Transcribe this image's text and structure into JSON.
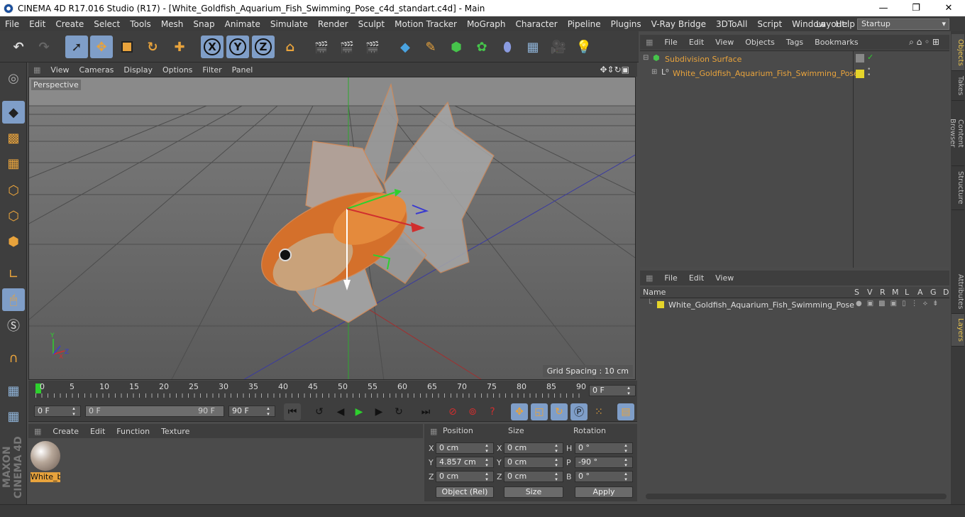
{
  "window": {
    "title": "CINEMA 4D R17.016 Studio (R17) - [White_Goldfish_Aquarium_Fish_Swimming_Pose_c4d_standart.c4d] - Main",
    "minimize": "—",
    "maximize": "❐",
    "close": "✕"
  },
  "menu": {
    "items": [
      "File",
      "Edit",
      "Create",
      "Select",
      "Tools",
      "Mesh",
      "Snap",
      "Animate",
      "Simulate",
      "Render",
      "Sculpt",
      "Motion Tracker",
      "MoGraph",
      "Character",
      "Pipeline",
      "Plugins",
      "V-Ray Bridge",
      "3DToAll",
      "Script",
      "Window",
      "Help"
    ],
    "layout_label": "Layout:",
    "layout_value": "Startup"
  },
  "toolbar": {
    "axis_x": "X",
    "axis_y": "Y",
    "axis_z": "Z"
  },
  "viewport": {
    "menu": [
      "View",
      "Cameras",
      "Display",
      "Options",
      "Filter",
      "Panel"
    ],
    "camera_label": "Perspective",
    "grid_spacing": "Grid Spacing : 10 cm",
    "axis_labels": {
      "x": "X",
      "y": "Y",
      "z": "Z"
    }
  },
  "timeline": {
    "ticks": [
      "0",
      "5",
      "10",
      "15",
      "20",
      "25",
      "30",
      "35",
      "40",
      "45",
      "50",
      "55",
      "60",
      "65",
      "70",
      "75",
      "80",
      "85",
      "90"
    ],
    "current_frame": "0 F",
    "start_field": "0 F",
    "range_start": "0 F",
    "range_end": "90 F",
    "end_field": "90 F"
  },
  "materials": {
    "menu": [
      "Create",
      "Edit",
      "Function",
      "Texture"
    ],
    "items": [
      {
        "label": "White_b"
      }
    ]
  },
  "coordinates": {
    "headers": {
      "position": "Position",
      "size": "Size",
      "rotation": "Rotation"
    },
    "rows": [
      {
        "axis": "X",
        "pos": "0 cm",
        "size_axis": "X",
        "size": "0 cm",
        "rot_axis": "H",
        "rot": "0 °"
      },
      {
        "axis": "Y",
        "pos": "4.857 cm",
        "size_axis": "Y",
        "size": "0 cm",
        "rot_axis": "P",
        "rot": "-90 °"
      },
      {
        "axis": "Z",
        "pos": "0 cm",
        "size_axis": "Z",
        "size": "0 cm",
        "rot_axis": "B",
        "rot": "0 °"
      }
    ],
    "mode_select": "Object (Rel)",
    "size_select": "Size",
    "apply": "Apply"
  },
  "objects": {
    "menu": [
      "File",
      "Edit",
      "View",
      "Objects",
      "Tags",
      "Bookmarks"
    ],
    "items": [
      {
        "name": "Subdivision Surface"
      },
      {
        "name": "White_Goldfish_Aquarium_Fish_Swimming_Pose"
      }
    ]
  },
  "layers": {
    "menu": [
      "File",
      "Edit",
      "View"
    ],
    "columns": {
      "name": "Name",
      "flags": [
        "S",
        "V",
        "R",
        "M",
        "L",
        "A",
        "G",
        "D"
      ]
    },
    "items": [
      {
        "name": "White_Goldfish_Aquarium_Fish_Swimming_Pose"
      }
    ]
  },
  "side_tabs": [
    "Objects",
    "Takes",
    "Content Browser",
    "Structure",
    "Attributes",
    "Layers"
  ],
  "branding": "MAXON CINEMA 4D",
  "colors": {
    "accent": "#e8a33c",
    "layer_yellow": "#e5d42a",
    "tool_active": "#7f9ec8"
  }
}
